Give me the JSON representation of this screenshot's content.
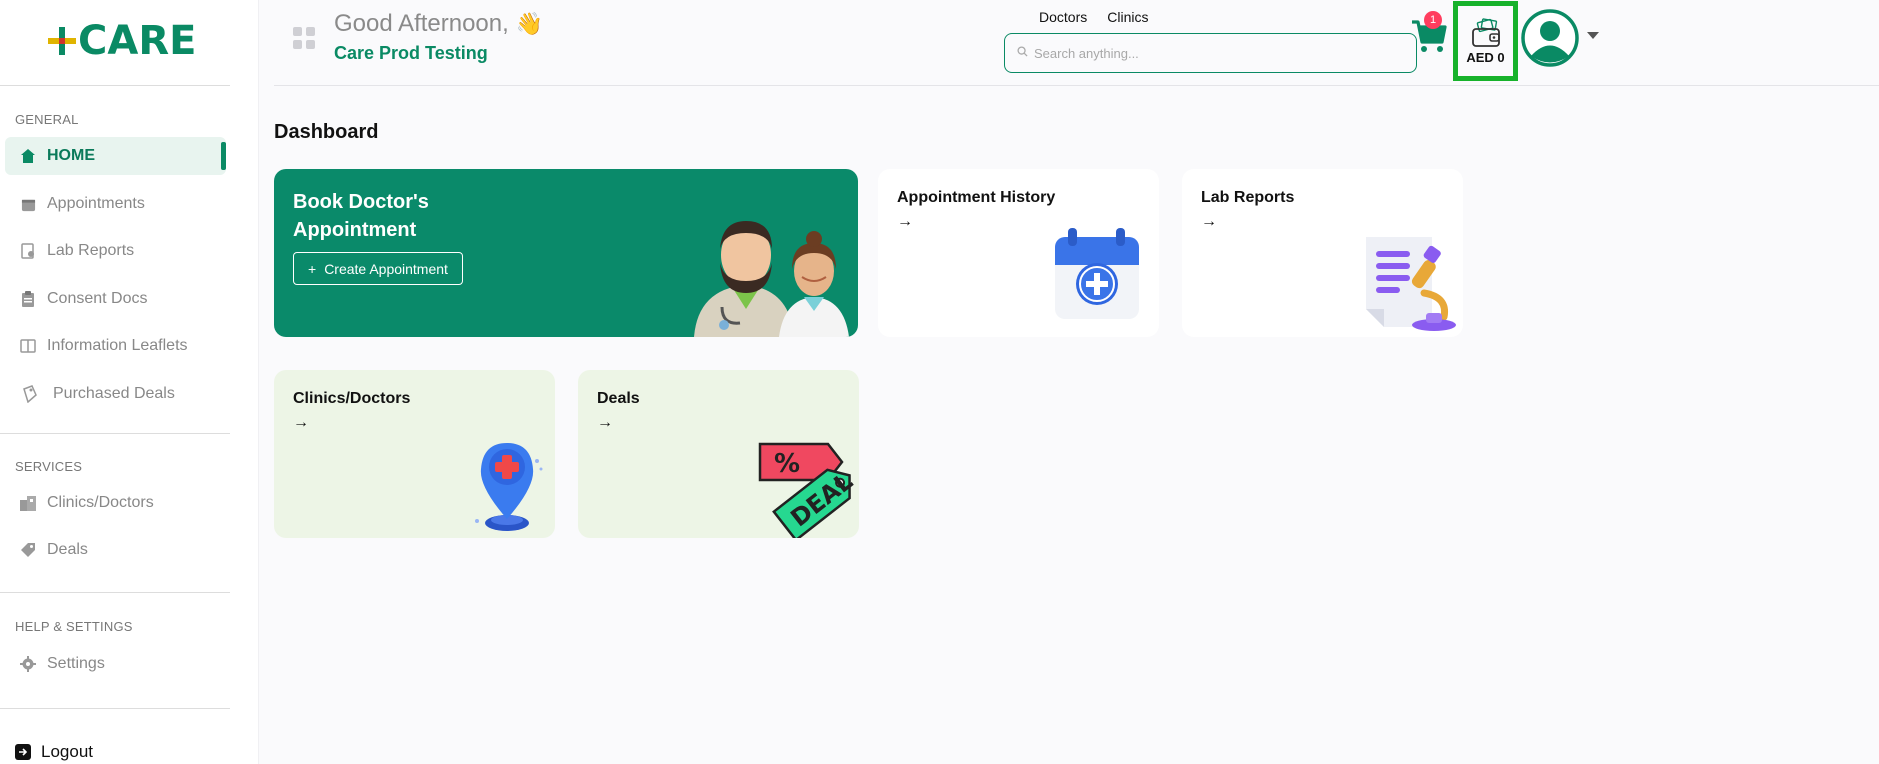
{
  "brand": {
    "logo_text": "CARE"
  },
  "sidebar": {
    "sections": [
      {
        "label": "GENERAL"
      },
      {
        "label": "SERVICES"
      },
      {
        "label": "HELP & SETTINGS"
      }
    ],
    "items": [
      {
        "label": "HOME",
        "icon": "home-icon"
      },
      {
        "label": "Appointments",
        "icon": "calendar-icon"
      },
      {
        "label": "Lab Reports",
        "icon": "lab-report-icon"
      },
      {
        "label": "Consent Docs",
        "icon": "clipboard-icon"
      },
      {
        "label": "Information Leaflets",
        "icon": "leaflet-icon"
      },
      {
        "label": "Purchased Deals",
        "icon": "purchased-deals-icon"
      },
      {
        "label": "Clinics/Doctors",
        "icon": "clinic-icon"
      },
      {
        "label": "Deals",
        "icon": "tag-icon"
      },
      {
        "label": "Settings",
        "icon": "gear-icon"
      }
    ],
    "logout_label": "Logout"
  },
  "header": {
    "greeting": "Good Afternoon,",
    "greeting_emoji": "👋",
    "username": "Care Prod Testing",
    "search_tabs": [
      "Doctors",
      "Clinics"
    ],
    "search_placeholder": "Search anything...",
    "cart_count": "1",
    "wallet_amount": "AED 0"
  },
  "main": {
    "title": "Dashboard",
    "book_card": {
      "title": "Book Doctor's Appointment",
      "button_label": "Create Appointment",
      "button_prefix": "+"
    },
    "cards": [
      {
        "label": "Appointment History",
        "arrow": "→"
      },
      {
        "label": "Lab Reports",
        "arrow": "→"
      },
      {
        "label": "Clinics/Doctors",
        "arrow": "→"
      },
      {
        "label": "Deals",
        "arrow": "→"
      }
    ],
    "deal_tag_text": "DEAL",
    "percent_text": "%"
  },
  "colors": {
    "brand_green": "#0a8a64",
    "card_green": "#0a8a6a",
    "light_card": "#edf5e6",
    "highlight": "#17b22b",
    "badge_red": "#ff3d5e"
  }
}
